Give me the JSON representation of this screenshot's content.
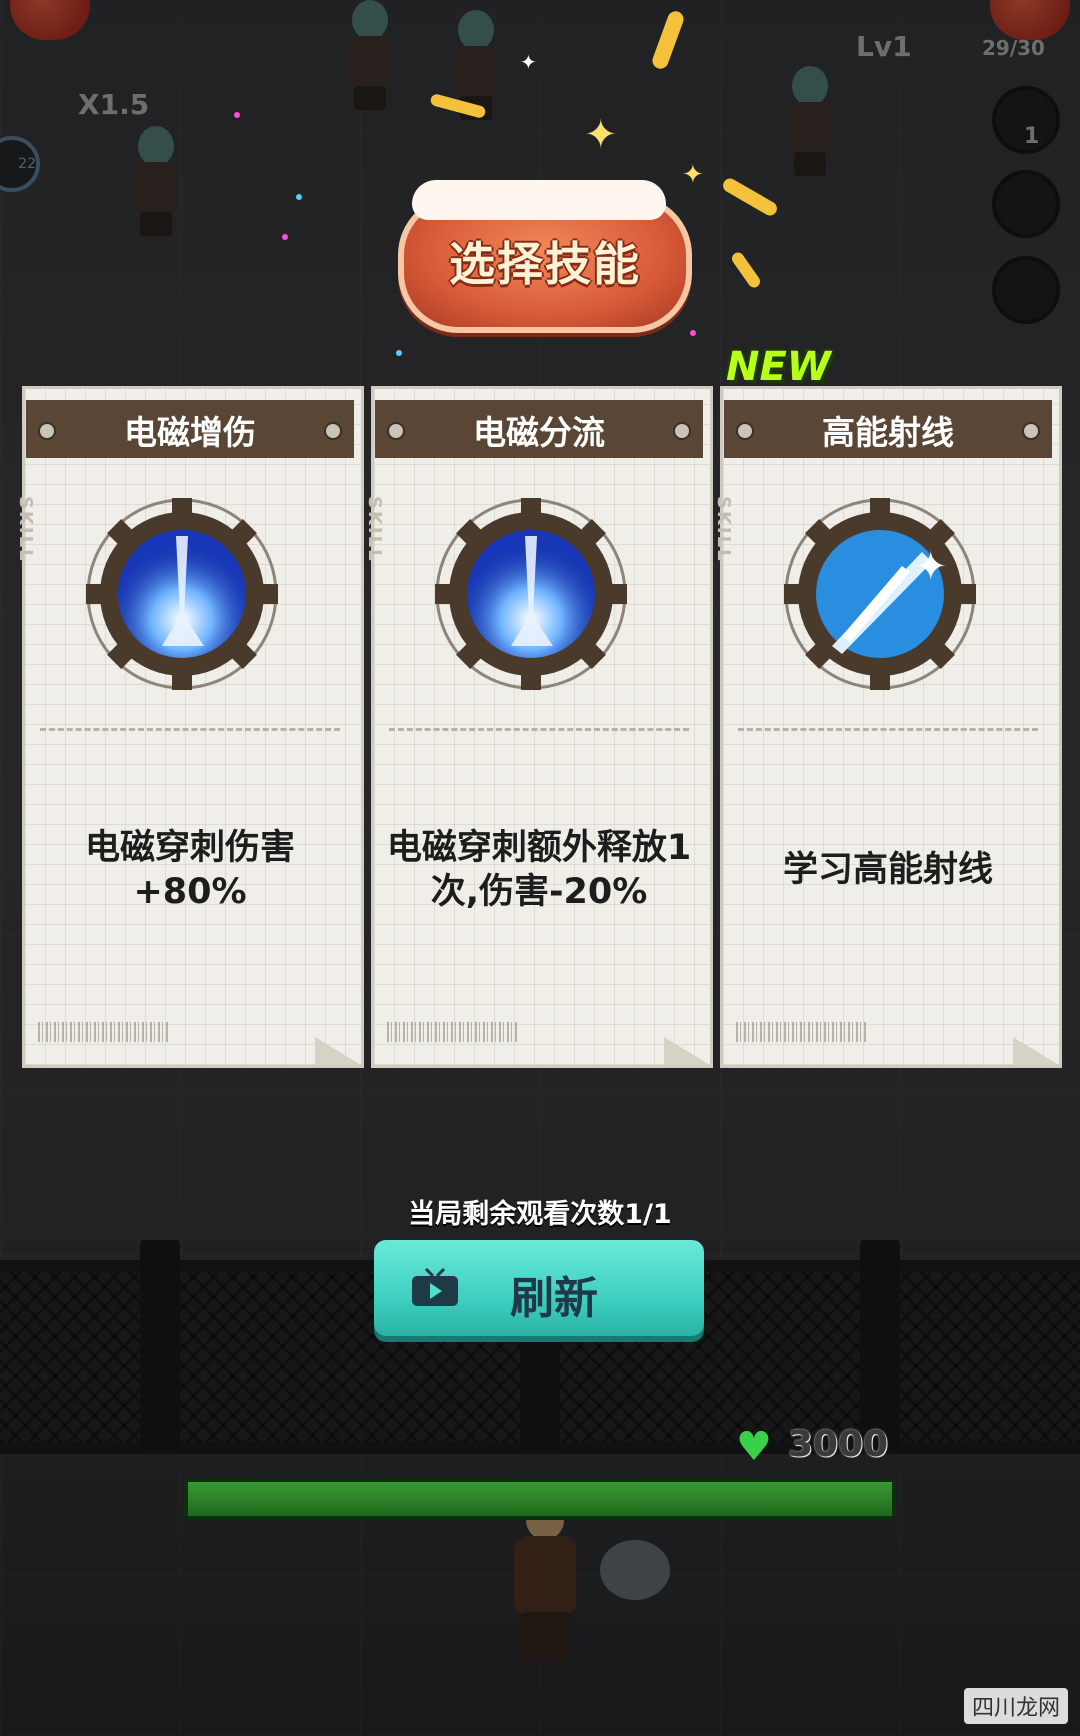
{
  "hud": {
    "speed": "X1.5",
    "level": "Lv1",
    "ammo": "29/30",
    "left_badge": "22",
    "right_count": "1"
  },
  "title": "选择技能",
  "new_badge": "NEW",
  "cards": [
    {
      "title": "电磁增伤",
      "tag": "SKILL",
      "icon": "electromagnetic-pierce-icon",
      "desc": "电磁穿刺伤害+80%"
    },
    {
      "title": "电磁分流",
      "tag": "SKILL",
      "icon": "electromagnetic-pierce-icon",
      "desc": "电磁穿刺额外释放1次,伤害-20%"
    },
    {
      "title": "高能射线",
      "tag": "SKILL",
      "icon": "high-energy-ray-icon",
      "desc": "学习高能射线"
    }
  ],
  "remaining_views": "当局剩余观看次数1/1",
  "refresh_button": {
    "label": "刷新",
    "icon": "tv-icon"
  },
  "hp": {
    "value": "3000",
    "icon": "heart-icon",
    "fill": 1.0
  },
  "watermark": "四川龙网",
  "colors": {
    "card_header": "#5a4634",
    "refresh_button": "#3ed0c0",
    "new_badge": "#b8ff1a",
    "hp_bar": "#2e8a2a"
  }
}
